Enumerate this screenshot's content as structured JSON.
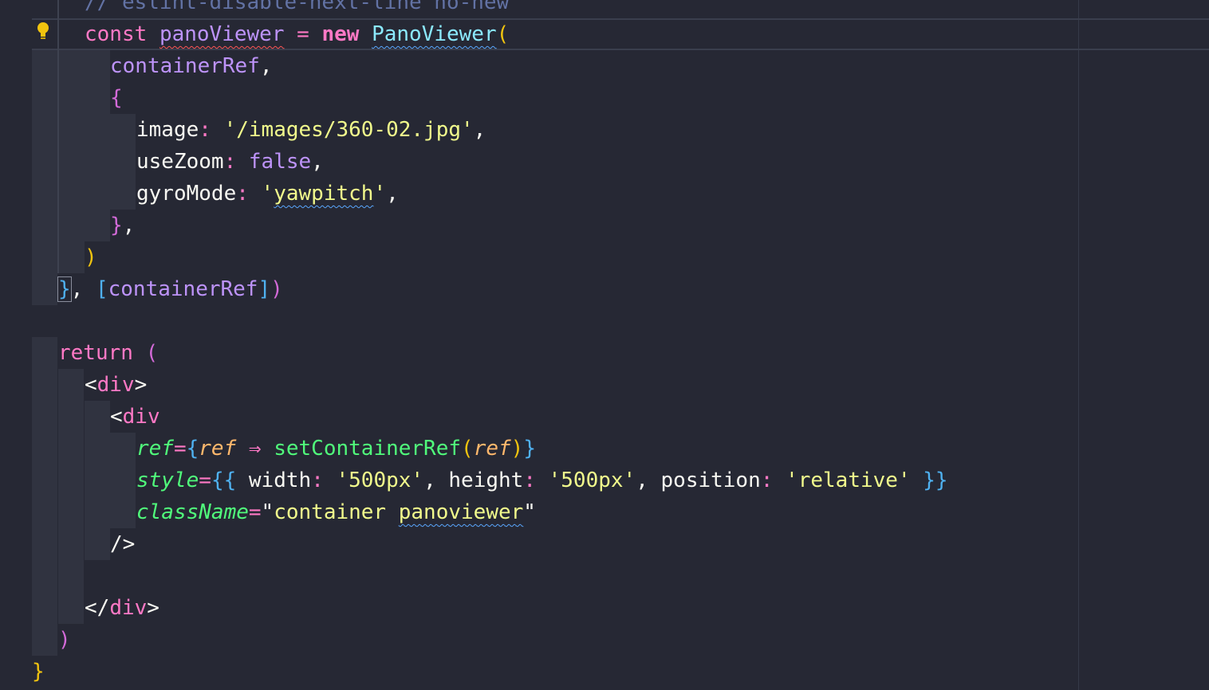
{
  "editor": {
    "language": "jsx",
    "theme": "dark",
    "colors": {
      "background": "#262834",
      "keyword": "#ff79c6",
      "variable": "#bd93f9",
      "string": "#f1fa8c",
      "class": "#8be9fd",
      "function": "#50fa7b",
      "parameter": "#ffb86c",
      "comment": "#6272a4"
    },
    "lightbulb_icon": "lightbulb-icon",
    "lines": [
      {
        "comment": "// eslint-disable-next-line no-new"
      },
      {
        "kw": "const",
        "var": "panoViewer",
        "op": "=",
        "new": "new",
        "cls": "PanoViewer",
        "paren": "("
      },
      {
        "var": "containerRef",
        "comma": ","
      },
      {
        "brace": "{"
      },
      {
        "key": "image",
        "colon": ":",
        "val": "'/images/360-02.jpg'",
        "comma": ","
      },
      {
        "key": "useZoom",
        "colon": ":",
        "val": "false",
        "comma": ","
      },
      {
        "key": "gyroMode",
        "colon": ":",
        "q1": "'",
        "val": "yawpitch",
        "q2": "'",
        "comma": ","
      },
      {
        "brace": "}",
        "comma": ","
      },
      {
        "paren": ")"
      },
      {
        "brace": "}",
        "comma": ",",
        "deps_open": "[",
        "deps_var": "containerRef",
        "deps_close": "]",
        "paren": ")"
      },
      {},
      {
        "kw": "return",
        "paren": "("
      },
      {
        "lt": "<",
        "tag": "div",
        "gt": ">"
      },
      {
        "lt": "<",
        "tag": "div"
      },
      {
        "attr": "ref",
        "eq": "=",
        "open": "{",
        "param": "ref",
        "arrow": "⇒",
        "fn": "setContainerRef",
        "popen": "(",
        "arg": "ref",
        "pclose": ")",
        "close": "}"
      },
      {
        "attr": "style",
        "eq": "=",
        "open": "{{",
        "k1": "width",
        "c1": ":",
        "v1": "'500px'",
        "sep1": ",",
        "k2": "height",
        "c2": ":",
        "v2": "'500px'",
        "sep2": ",",
        "k3": "position",
        "c3": ":",
        "v3": "'relative'",
        "close": "}}"
      },
      {
        "attr": "className",
        "eq": "=",
        "q1": "\"",
        "s1": "container ",
        "s2": "panoviewer",
        "q2": "\""
      },
      {
        "selfclose": "/>"
      },
      {},
      {
        "lt": "</",
        "tag": "div",
        "gt": ">"
      },
      {
        "paren": ")"
      },
      {
        "brace": "}"
      }
    ]
  }
}
